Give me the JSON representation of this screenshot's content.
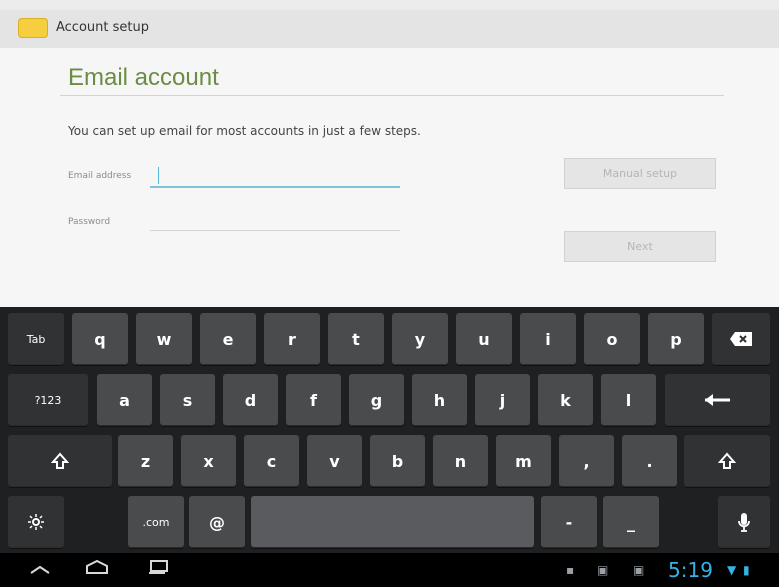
{
  "action_bar": {
    "title": "Account setup",
    "icon": "email-app-icon"
  },
  "form": {
    "heading": "Email account",
    "intro": "You can set up email for most accounts in just a few steps.",
    "email_label": "Email address",
    "email_value": "",
    "password_label": "Password",
    "password_value": "",
    "manual_setup_label": "Manual setup",
    "next_label": "Next"
  },
  "keyboard": {
    "row1": [
      "Tab",
      "q",
      "w",
      "e",
      "r",
      "t",
      "y",
      "u",
      "i",
      "o",
      "p"
    ],
    "row2": [
      "?123",
      "a",
      "s",
      "d",
      "f",
      "g",
      "h",
      "j",
      "k",
      "l"
    ],
    "row3": [
      "z",
      "x",
      "c",
      "v",
      "b",
      "n",
      "m",
      ",",
      "."
    ],
    "row4": [
      ".com",
      "@",
      "-",
      "_"
    ],
    "icons": [
      "backspace-icon",
      "enter-icon",
      "shift-icon",
      "settings-icon",
      "voice-input-icon"
    ]
  },
  "status_bar": {
    "time": "5:19",
    "icons": [
      "back-icon",
      "home-icon",
      "recent-apps-icon",
      "notification-icon",
      "notification-icon",
      "wifi-icon",
      "battery-icon"
    ]
  }
}
